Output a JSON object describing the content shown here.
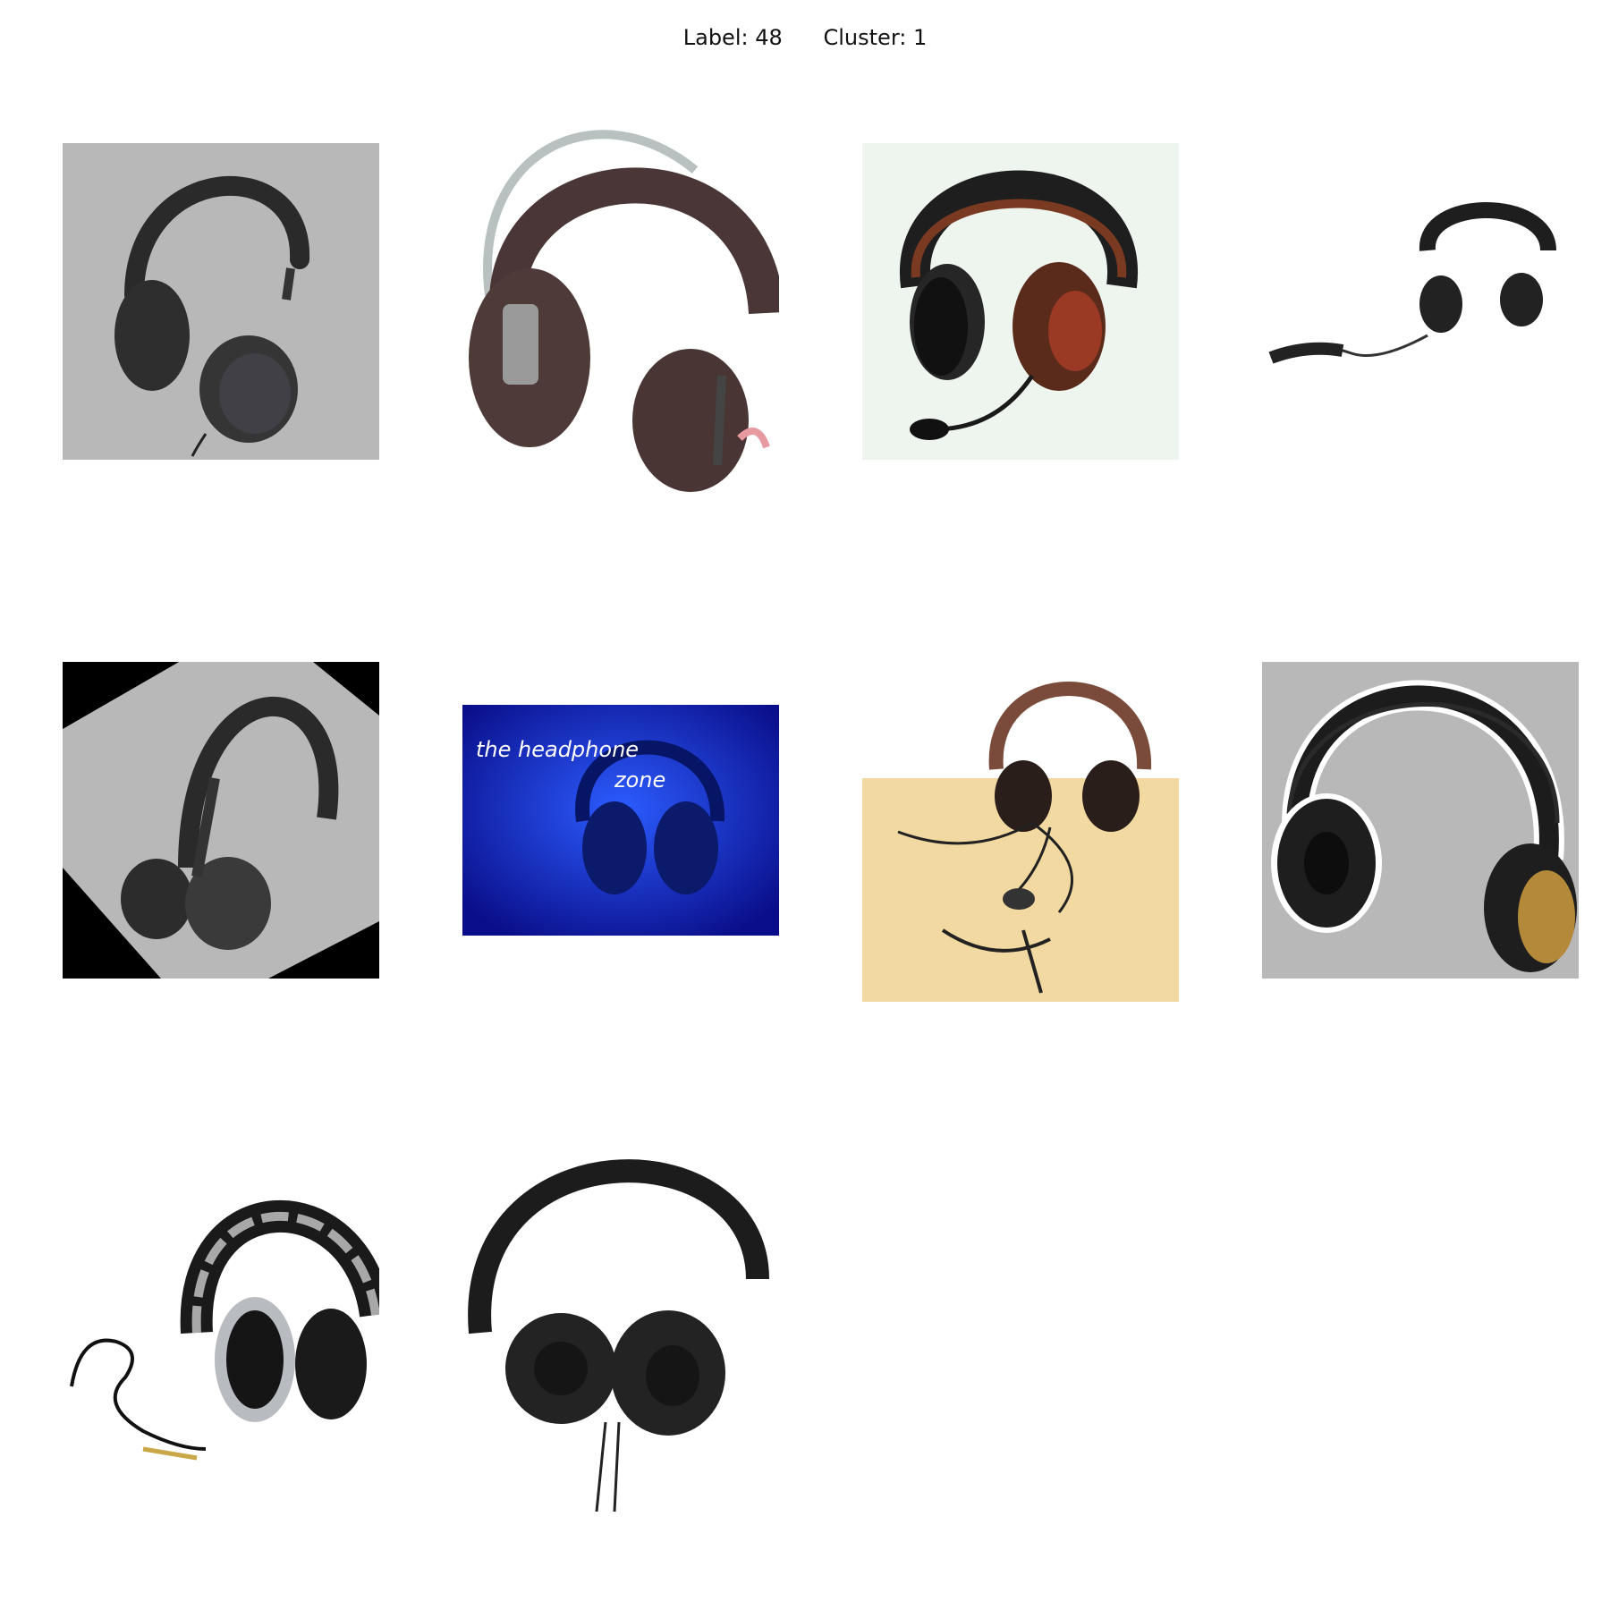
{
  "header": {
    "title": "Label: 48      Cluster: 1"
  },
  "images": [
    {
      "subject": "headphones-gray-background",
      "background": "#b8b8b8"
    },
    {
      "subject": "headphones-sennheiser-foam",
      "background": "#ffffff"
    },
    {
      "subject": "gaming-headset-with-mic",
      "background": "#eef4ee"
    },
    {
      "subject": "small-headphones-with-cable",
      "background": "#ffffff"
    },
    {
      "subject": "headphones-rotated-black-corners",
      "background": "#b8b8b8"
    },
    {
      "subject": "headphone-zone-poster",
      "background": "#1030d0",
      "caption_line1": "the headphone",
      "caption_line2": "zone"
    },
    {
      "subject": "headset-on-wooden-table",
      "background": "#f2d9a2"
    },
    {
      "subject": "akg-headphones-gray",
      "background": "#b8b8b8"
    },
    {
      "subject": "pioneer-dj-headphones",
      "background": "#ffffff"
    },
    {
      "subject": "sennheiser-headphones-black",
      "background": "#ffffff"
    }
  ]
}
